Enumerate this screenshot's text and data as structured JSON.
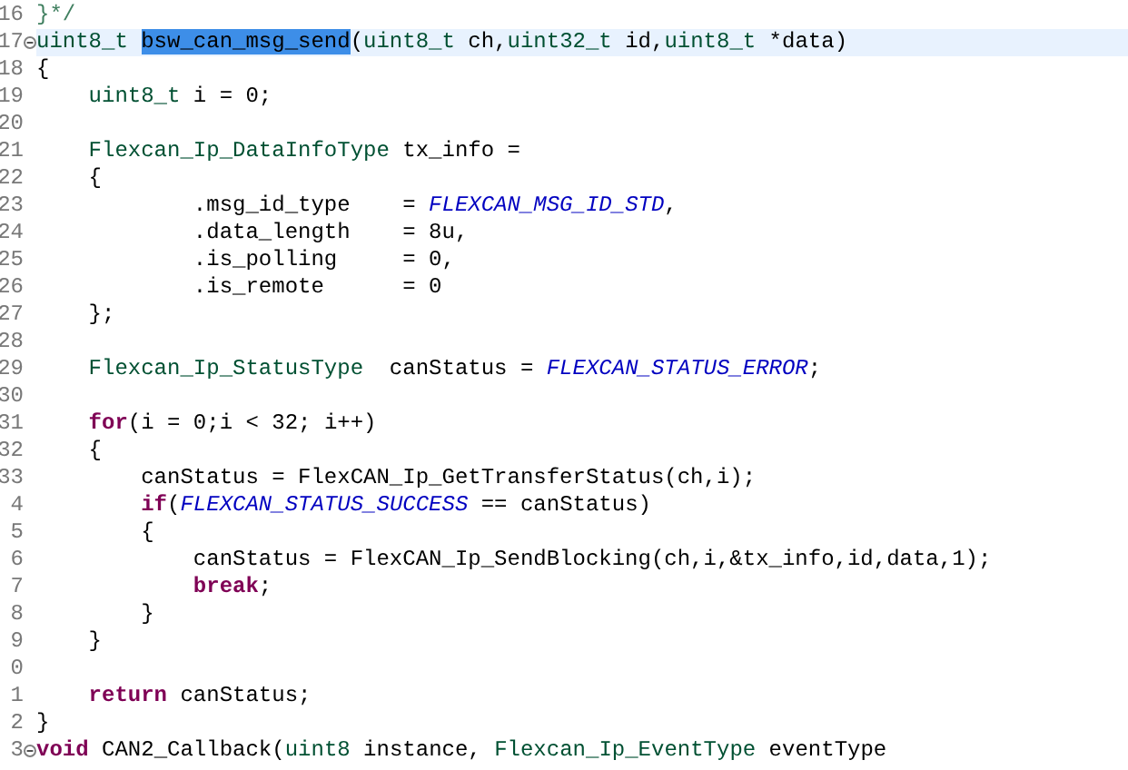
{
  "editor": {
    "lines": [
      {
        "number": "16",
        "fold": false,
        "current": false,
        "tokens": [
          {
            "kind": "comment",
            "text": "}*/"
          }
        ]
      },
      {
        "number": "17",
        "fold": true,
        "current": true,
        "tokens": [
          {
            "kind": "type",
            "text": "uint8_t "
          },
          {
            "kind": "selected",
            "text": "bsw_can_msg_send"
          },
          {
            "kind": "plain",
            "text": "("
          },
          {
            "kind": "type",
            "text": "uint8_t"
          },
          {
            "kind": "plain",
            "text": " ch,"
          },
          {
            "kind": "type",
            "text": "uint32_t"
          },
          {
            "kind": "plain",
            "text": " id,"
          },
          {
            "kind": "type",
            "text": "uint8_t"
          },
          {
            "kind": "plain",
            "text": " *data)"
          }
        ]
      },
      {
        "number": "18",
        "fold": false,
        "current": false,
        "tokens": [
          {
            "kind": "plain",
            "text": "{"
          }
        ]
      },
      {
        "number": "19",
        "fold": false,
        "current": false,
        "tokens": [
          {
            "kind": "type",
            "text": "    uint8_t"
          },
          {
            "kind": "plain",
            "text": " i = 0;"
          }
        ]
      },
      {
        "number": "20",
        "fold": false,
        "current": false
      },
      {
        "number": "21",
        "fold": false,
        "current": false,
        "tokens": [
          {
            "kind": "type",
            "text": "    Flexcan_Ip_DataInfoType"
          },
          {
            "kind": "plain",
            "text": " tx_info ="
          }
        ]
      },
      {
        "number": "22",
        "fold": false,
        "current": false,
        "tokens": [
          {
            "kind": "plain",
            "text": "    {"
          }
        ]
      },
      {
        "number": "23",
        "fold": false,
        "current": false,
        "tokens": [
          {
            "kind": "plain",
            "text": "            .msg_id_type    = "
          },
          {
            "kind": "macro",
            "text": "FLEXCAN_MSG_ID_STD"
          },
          {
            "kind": "plain",
            "text": ","
          }
        ]
      },
      {
        "number": "24",
        "fold": false,
        "current": false,
        "tokens": [
          {
            "kind": "plain",
            "text": "            .data_length    = 8u,"
          }
        ]
      },
      {
        "number": "25",
        "fold": false,
        "current": false,
        "tokens": [
          {
            "kind": "plain",
            "text": "            .is_polling     = 0,"
          }
        ]
      },
      {
        "number": "26",
        "fold": false,
        "current": false,
        "tokens": [
          {
            "kind": "plain",
            "text": "            .is_remote      = 0"
          }
        ]
      },
      {
        "number": "27",
        "fold": false,
        "current": false,
        "tokens": [
          {
            "kind": "plain",
            "text": "    };"
          }
        ]
      },
      {
        "number": "28",
        "fold": false,
        "current": false
      },
      {
        "number": "29",
        "fold": false,
        "current": false,
        "tokens": [
          {
            "kind": "type",
            "text": "    Flexcan_Ip_StatusType"
          },
          {
            "kind": "plain",
            "text": "  canStatus = "
          },
          {
            "kind": "macro",
            "text": "FLEXCAN_STATUS_ERROR"
          },
          {
            "kind": "plain",
            "text": ";"
          }
        ]
      },
      {
        "number": "30",
        "fold": false,
        "current": false
      },
      {
        "number": "31",
        "fold": false,
        "current": false,
        "tokens": [
          {
            "kind": "keyword",
            "text": "    for"
          },
          {
            "kind": "plain",
            "text": "(i = 0;i < 32; i++)"
          }
        ]
      },
      {
        "number": "32",
        "fold": false,
        "current": false,
        "tokens": [
          {
            "kind": "plain",
            "text": "    {"
          }
        ]
      },
      {
        "number": "33",
        "fold": false,
        "current": false,
        "tokens": [
          {
            "kind": "plain",
            "text": "        canStatus = FlexCAN_Ip_GetTransferStatus(ch,i);"
          }
        ]
      },
      {
        "number": "4",
        "fold": false,
        "current": false,
        "tokens": [
          {
            "kind": "keyword",
            "text": "        if"
          },
          {
            "kind": "plain",
            "text": "("
          },
          {
            "kind": "macro",
            "text": "FLEXCAN_STATUS_SUCCESS"
          },
          {
            "kind": "plain",
            "text": " == canStatus)"
          }
        ]
      },
      {
        "number": "5",
        "fold": false,
        "current": false,
        "tokens": [
          {
            "kind": "plain",
            "text": "        {"
          }
        ]
      },
      {
        "number": "6",
        "fold": false,
        "current": false,
        "tokens": [
          {
            "kind": "plain",
            "text": "            canStatus = FlexCAN_Ip_SendBlocking(ch,i,&tx_info,id,data,1);"
          }
        ]
      },
      {
        "number": "7",
        "fold": false,
        "current": false,
        "tokens": [
          {
            "kind": "keyword",
            "text": "            break"
          },
          {
            "kind": "plain",
            "text": ";"
          }
        ]
      },
      {
        "number": "8",
        "fold": false,
        "current": false,
        "tokens": [
          {
            "kind": "plain",
            "text": "        }"
          }
        ]
      },
      {
        "number": "9",
        "fold": false,
        "current": false,
        "tokens": [
          {
            "kind": "plain",
            "text": "    }"
          }
        ]
      },
      {
        "number": "0",
        "fold": false,
        "current": false
      },
      {
        "number": "1",
        "fold": false,
        "current": false,
        "tokens": [
          {
            "kind": "keyword",
            "text": "    return"
          },
          {
            "kind": "plain",
            "text": " canStatus;"
          }
        ]
      },
      {
        "number": "2",
        "fold": false,
        "current": false,
        "tokens": [
          {
            "kind": "plain",
            "text": "}"
          }
        ]
      },
      {
        "number": "3",
        "fold": true,
        "current": false,
        "tokens": [
          {
            "kind": "keyword",
            "text": "void"
          },
          {
            "kind": "plain",
            "text": " CAN2_Callback("
          },
          {
            "kind": "type",
            "text": "uint8"
          },
          {
            "kind": "plain",
            "text": " instance, "
          },
          {
            "kind": "type",
            "text": "Flexcan_Ip_EventType"
          },
          {
            "kind": "plain",
            "text": " eventType"
          }
        ]
      }
    ]
  }
}
